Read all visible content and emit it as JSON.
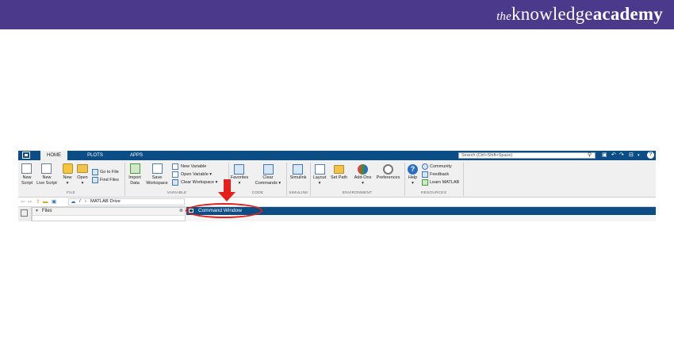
{
  "banner": {
    "brand_the": "the",
    "brand_main": "knowledge",
    "brand_bold": "academy",
    "background": "#4b3a8c"
  },
  "toolbar": {
    "tabs": [
      "HOME",
      "PLOTS",
      "APPS"
    ],
    "active_tab": "HOME",
    "search_placeholder": "Search (Ctrl+Shift+Space)",
    "accent": "#0d4d85",
    "icons": [
      "matlab-logo-icon",
      "search-icon",
      "save-icon",
      "undo-icon",
      "redo-icon",
      "layout-icon",
      "help-icon"
    ]
  },
  "ribbon": {
    "file": {
      "new_script": [
        "New",
        "Script"
      ],
      "new_live_script": [
        "New",
        "Live Script"
      ],
      "new": "New",
      "open": "Open",
      "go_to_file": "Go to File",
      "find_files": "Find Files",
      "section": "FILE"
    },
    "variable": {
      "import_data": [
        "Import",
        "Data"
      ],
      "save_workspace": [
        "Save",
        "Workspace"
      ],
      "new_variable": "New Variable",
      "open_variable": "Open Variable",
      "clear_workspace": "Clear Workspace",
      "section": "VARIABLE"
    },
    "code": {
      "favorites": "Favorites",
      "clear_commands": [
        "Clear",
        "Commands"
      ],
      "section": "CODE"
    },
    "simulink": {
      "simulink": "Simulink",
      "section": "SIMULINK"
    },
    "environment": {
      "layout": "Layout",
      "set_path": "Set Path",
      "add_ons": "Add-Ons",
      "preferences": "Preferences",
      "section": "ENVIRONMENT"
    },
    "resources": {
      "help": "Help",
      "community": "Community",
      "feedback": "Feedback",
      "learn_matlab": "Learn MATLAB",
      "section": "RESOURCES"
    }
  },
  "address_bar": {
    "path_root": "/",
    "path_sep": "›",
    "path_folder": "MATLAB Drive"
  },
  "files_panel": {
    "title": "Files"
  },
  "command_window": {
    "title": "Command Window"
  },
  "annotation": {
    "color": "#e3201b"
  }
}
